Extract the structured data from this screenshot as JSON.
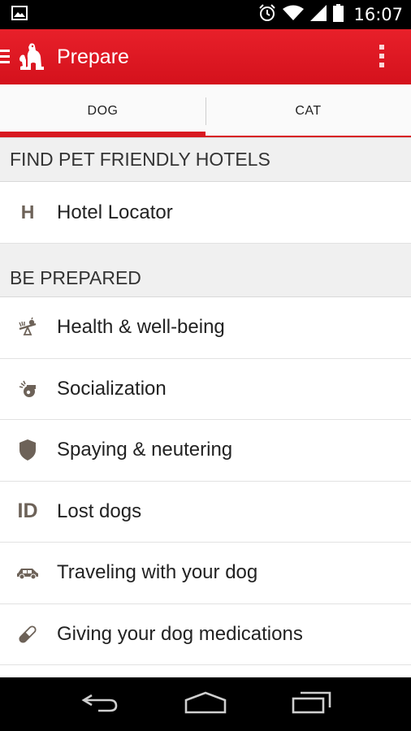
{
  "status": {
    "time": "16:07"
  },
  "app_bar": {
    "title": "Prepare"
  },
  "tabs": [
    {
      "label": "DOG",
      "active": true
    },
    {
      "label": "CAT",
      "active": false
    }
  ],
  "sections": [
    {
      "header": "FIND PET FRIENDLY HOTELS",
      "items": [
        {
          "label": "Hotel Locator",
          "icon": "hotel-h-icon"
        }
      ]
    },
    {
      "header": "BE PREPARED",
      "items": [
        {
          "label": "Health & well-being",
          "icon": "seesaw-health-icon"
        },
        {
          "label": "Socialization",
          "icon": "whistle-icon"
        },
        {
          "label": "Spaying & neutering",
          "icon": "shield-icon"
        },
        {
          "label": "Lost dogs",
          "icon": "id-tag-icon"
        },
        {
          "label": "Traveling with your dog",
          "icon": "car-icon"
        },
        {
          "label": "Giving your dog medications",
          "icon": "pill-capsule-icon"
        }
      ]
    }
  ],
  "colors": {
    "accent": "#d81920",
    "icon": "#6d6258"
  }
}
